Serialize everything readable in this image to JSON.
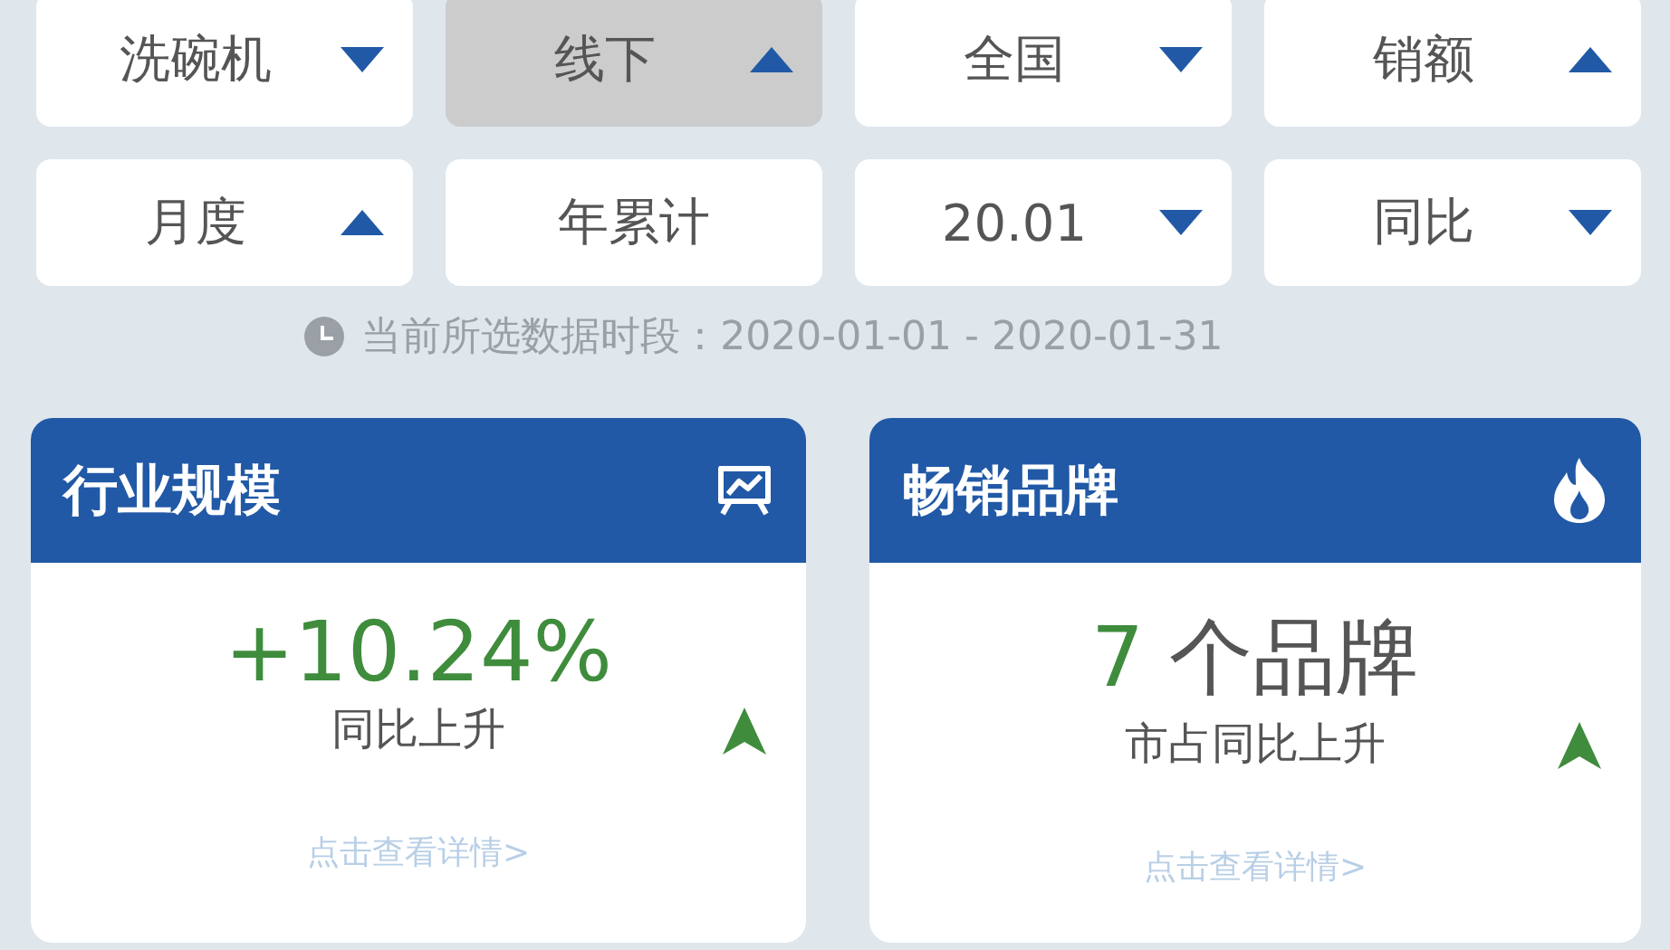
{
  "filters": [
    {
      "label": "洗碗机",
      "kind": "descending",
      "selected": false
    },
    {
      "label": "线下",
      "kind": "ascending",
      "selected": true
    },
    {
      "label": "全国",
      "kind": "descending",
      "selected": false
    },
    {
      "label": "销额",
      "kind": "ascending",
      "selected": false
    },
    {
      "label": "月度",
      "kind": "ascending",
      "selected": false
    },
    {
      "label": "年累计",
      "kind": "plain",
      "selected": false
    },
    {
      "label": "20.01",
      "kind": "descending",
      "selected": false
    },
    {
      "label": "同比",
      "kind": "descending",
      "selected": false
    }
  ],
  "period": "当前所选数据时段：2020-01-01 - 2020-01-31",
  "cards": [
    {
      "kind": "scale",
      "title": "行业规模",
      "value": "+10.24%",
      "caption": "同比上升",
      "rising": true,
      "link": "点击查看详情>"
    },
    {
      "kind": "ranking",
      "title": "畅销品牌",
      "value": "7",
      "unit": "个品牌",
      "caption": "市占同比上升",
      "rising": true,
      "link": "点击查看详情>"
    }
  ]
}
